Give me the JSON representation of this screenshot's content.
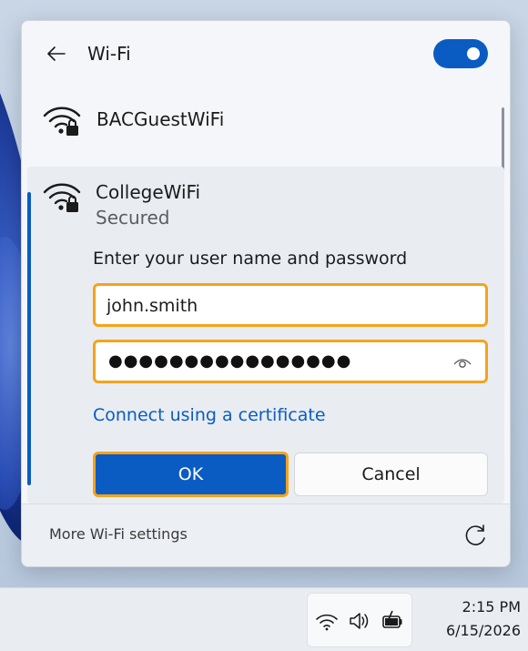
{
  "flyout": {
    "title": "Wi-Fi",
    "wifi_enabled": true
  },
  "networks": [
    {
      "name": "BACGuestWiFi",
      "secured": true
    },
    {
      "name": "CollegeWiFi",
      "status": "Secured",
      "secured": true,
      "expanded": true
    }
  ],
  "login": {
    "prompt": "Enter your user name and password",
    "username_value": "john.smith",
    "password_mask": "●●●●●●●●●●●●●●●●",
    "certificate_link": "Connect using a certificate",
    "ok_label": "OK",
    "cancel_label": "Cancel"
  },
  "footer": {
    "more_settings_label": "More Wi-Fi settings"
  },
  "taskbar": {
    "time": "2:15 PM",
    "date": "6/15/2026"
  },
  "colors": {
    "accent": "#0a5cc2",
    "focus_ring": "#f5a31a"
  }
}
